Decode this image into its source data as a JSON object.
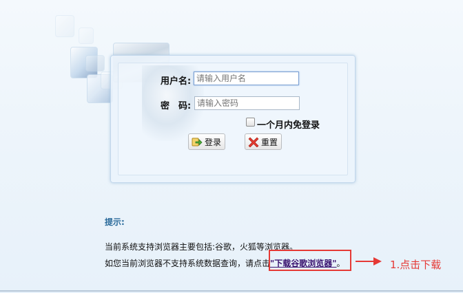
{
  "login": {
    "username_label": "用户名:",
    "username_placeholder": "请输入用户名",
    "password_label": "密　码:",
    "password_placeholder": "请输入密码",
    "remember_label": "一个月内免登录",
    "login_button": "登录",
    "reset_button": "重置"
  },
  "tips": {
    "title": "提示:",
    "line1": "当前系统支持浏览器主要包括:谷歌，火狐等浏览器。",
    "line2_prefix": "如您当前浏览器不支持系统数据查询，请点击",
    "download_link": "\"下载谷歌浏览器\"",
    "line2_suffix": "。"
  },
  "annotation": {
    "text": "1.点击下载",
    "color": "#e53935"
  },
  "icons": {
    "login": "login-arrow-icon",
    "reset": "red-x-icon",
    "arrow": "right-arrow-icon"
  }
}
